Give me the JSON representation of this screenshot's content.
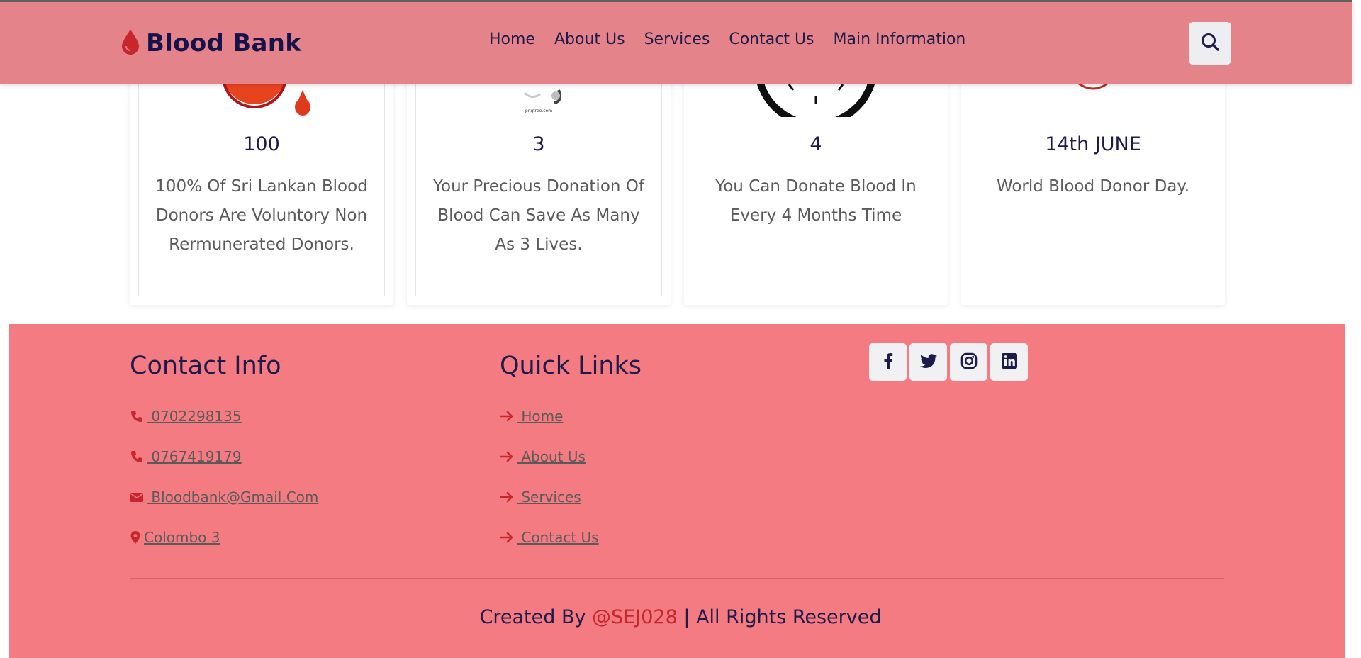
{
  "header": {
    "logo_text": "Blood Bank",
    "logo_icon": "blood-drop-icon",
    "nav": [
      "Home",
      "About Us",
      "Services",
      "Contact Us",
      "Main Information"
    ],
    "search_icon": "search-icon"
  },
  "stats": [
    {
      "value": "100",
      "text": "100% Of Sri Lankan Blood Donors Are Voluntory Non Rermunerated Donors.",
      "image": "blood-drops"
    },
    {
      "value": "3",
      "text": "Your Precious Donation Of Blood Can Save As Many As 3 Lives.",
      "image": "blood-bag",
      "image_caption": "pngtree.com"
    },
    {
      "value": "4",
      "text": "You Can Donate Blood In Every 4 Months Time",
      "image": "clock"
    },
    {
      "value": "14th JUNE",
      "text": "World Blood Donor Day.",
      "image": "heart"
    }
  ],
  "footer": {
    "contact_title": "Contact Info",
    "contacts": [
      {
        "icon": "phone-icon",
        "text": " 0702298135"
      },
      {
        "icon": "phone-icon",
        "text": " 0767419179"
      },
      {
        "icon": "envelope-icon",
        "text": " Bloodbank@Gmail.Com"
      },
      {
        "icon": "map-pin-icon",
        "text": "Colombo 3"
      }
    ],
    "links_title": "Quick Links",
    "links": [
      " Home",
      " About Us",
      " Services",
      " Contact Us"
    ],
    "social": [
      "facebook-icon",
      "twitter-icon",
      "instagram-icon",
      "linkedin-icon"
    ],
    "credit_prefix": "Created By ",
    "credit_handle": "@SEJ028",
    "credit_suffix": " | All Rights Reserved"
  },
  "colors": {
    "header_bg": "#e4848a",
    "footer_bg": "#f37b81",
    "primary_text": "#1e1b4b",
    "accent_red": "#c8262d"
  }
}
